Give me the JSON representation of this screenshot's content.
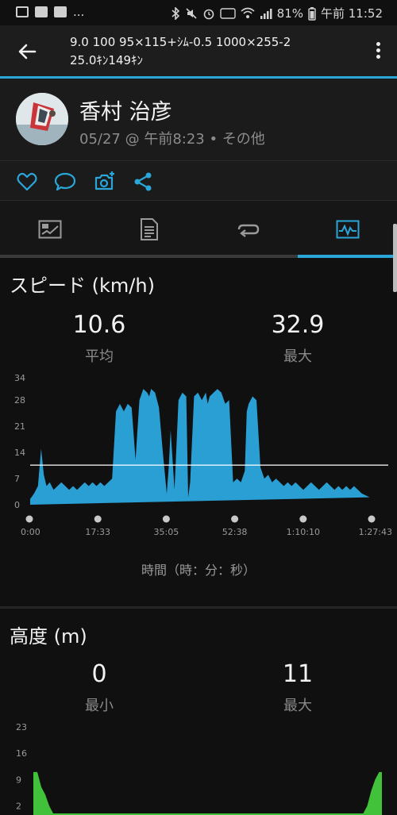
{
  "status_bar": {
    "dots": "...",
    "battery": "81%",
    "time": "午前 11:52"
  },
  "header": {
    "title_line1": "9.0 100 95×115+ｼﾑ-0.5 1000×255-2",
    "title_line2": "25.0ｷﾝ149ｷﾝ"
  },
  "profile": {
    "name": "香村 治彦",
    "meta": "05/27 @ 午前8:23 • その他"
  },
  "actions": [
    "heart-icon",
    "comment-icon",
    "camera-add-icon",
    "share-icon"
  ],
  "tabs": [
    {
      "icon": "summary-icon",
      "active": false
    },
    {
      "icon": "details-icon",
      "active": false
    },
    {
      "icon": "laps-icon",
      "active": false
    },
    {
      "icon": "charts-icon",
      "active": true
    }
  ],
  "speed": {
    "title": "スピード (km/h)",
    "avg_value": "10.6",
    "avg_label": "平均",
    "max_value": "32.9",
    "max_label": "最大",
    "x_caption": "時間（時：分：秒）"
  },
  "altitude": {
    "title": "高度 (m)",
    "min_value": "0",
    "min_label": "最小",
    "max_value": "11",
    "max_label": "最大"
  },
  "colors": {
    "accent": "#2ba6d9",
    "speed_fill": "#2a9fd4",
    "altitude_fill": "#42c23a",
    "app_bar": "#1d1d1d"
  },
  "chart_data": [
    {
      "type": "area",
      "y_ticks": [
        "34",
        "28",
        "21",
        "14",
        "7",
        "0"
      ],
      "x_ticks": [
        "0:00",
        "17:33",
        "35:05",
        "52:38",
        "1:10:10",
        "1:27:43"
      ],
      "ylim": [
        0,
        34
      ],
      "x_minutes": [
        0,
        1,
        2,
        2.8,
        3.5,
        4.2,
        5,
        6,
        7,
        8,
        9,
        10,
        11,
        12,
        13,
        14,
        15,
        16,
        17,
        18,
        19,
        20,
        21,
        22,
        22.5,
        23,
        24,
        25,
        26,
        27,
        28,
        29,
        30,
        30.5,
        31,
        32,
        33,
        34,
        35,
        35.5,
        36,
        37,
        38,
        39,
        40,
        40.5,
        41,
        42,
        43,
        44,
        45,
        45.5,
        46,
        47,
        48,
        49,
        50,
        51,
        52,
        53,
        54,
        55,
        55.5,
        56,
        57,
        58,
        59,
        60,
        61,
        62,
        63,
        64,
        65,
        66,
        67,
        68,
        69,
        70,
        71,
        72,
        73,
        74,
        75,
        76,
        77,
        78,
        79,
        80,
        81,
        82,
        83,
        84,
        85,
        86,
        87,
        87.7
      ],
      "values": [
        1.5,
        3,
        5,
        15,
        8,
        5,
        6,
        4,
        5,
        6,
        5,
        4,
        5,
        4,
        5,
        6,
        5,
        6,
        5,
        6,
        5,
        6,
        7,
        25,
        26,
        27,
        25,
        27,
        26,
        12,
        28,
        31,
        30,
        29,
        31,
        30,
        26,
        14,
        3,
        10,
        20,
        4,
        28,
        30,
        29,
        2,
        6,
        29,
        30,
        28,
        30,
        27,
        29,
        30,
        31,
        30,
        27,
        28,
        6,
        7,
        6,
        9,
        25,
        27,
        29,
        28,
        10,
        7,
        8,
        6,
        7,
        6,
        5,
        6,
        5,
        6,
        5,
        4,
        5,
        6,
        5,
        4,
        5,
        6,
        5,
        4,
        5,
        4,
        5,
        4,
        5,
        4,
        3,
        2.5,
        2
      ],
      "reference_line": 10.6,
      "xlabel": "時間（時：分：秒）"
    },
    {
      "type": "area",
      "y_ticks": [
        "23",
        "16",
        "9",
        "2"
      ],
      "ylim": [
        0,
        23
      ],
      "x_minutes": [
        0,
        1,
        2,
        3,
        4,
        5,
        83,
        84,
        85,
        86,
        87,
        87.7
      ],
      "values": [
        11,
        11,
        7,
        5,
        2,
        0,
        0,
        2,
        6,
        9,
        11,
        11
      ]
    }
  ]
}
